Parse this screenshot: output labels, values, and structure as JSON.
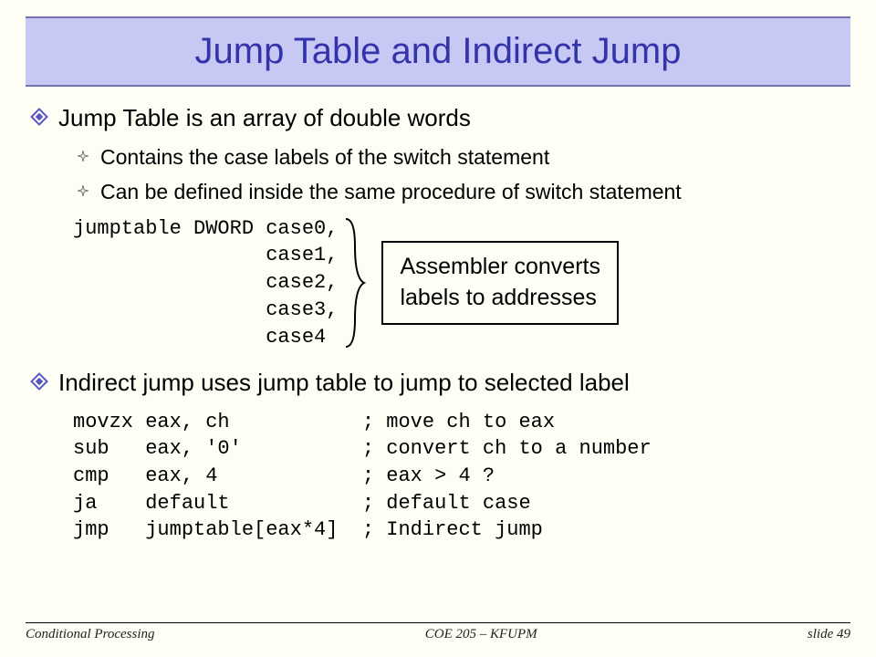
{
  "title": "Jump Table and Indirect Jump",
  "bullet1": {
    "text": "Jump Table is an array of double words",
    "subs": [
      "Contains the case labels of the switch statement",
      "Can be defined inside the same procedure of switch statement"
    ]
  },
  "jumptable_code": "jumptable DWORD case0,\n                case1,\n                case2,\n                case3,\n                case4",
  "annotation": {
    "line1": "Assembler converts",
    "line2": "labels to addresses"
  },
  "bullet2": {
    "text": "Indirect jump uses jump table to jump to selected label"
  },
  "asm_code": "movzx eax, ch           ; move ch to eax\nsub   eax, '0'          ; convert ch to a number\ncmp   eax, 4            ; eax > 4 ?\nja    default           ; default case\njmp   jumptable[eax*4]  ; Indirect jump",
  "footer": {
    "left": "Conditional Processing",
    "center": "COE 205 – KFUPM",
    "right": "slide 49"
  }
}
